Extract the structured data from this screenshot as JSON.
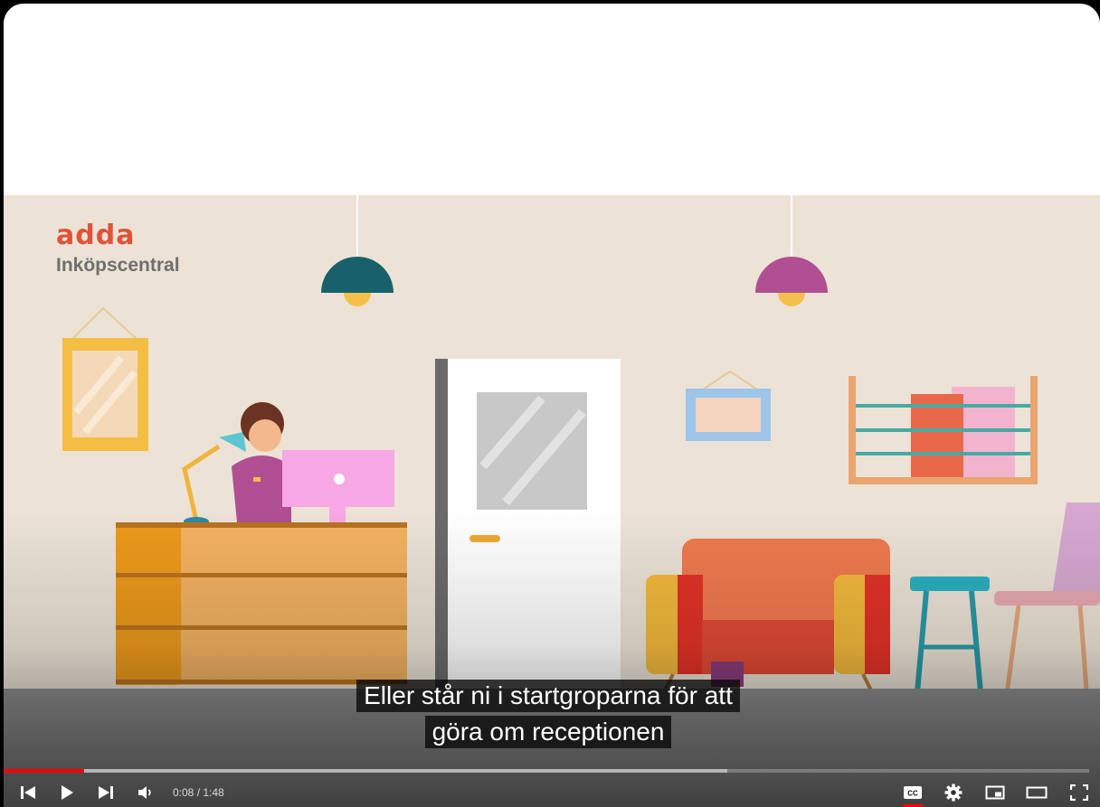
{
  "player": {
    "captions": [
      "Eller står ni i startgroparna för att",
      "göra om receptionen"
    ],
    "time_current": "0:08",
    "time_separator": " / ",
    "time_total": "1:48",
    "played_fraction": 0.074,
    "buffered_fraction": 0.667,
    "accent_color": "#ff0000"
  },
  "scene": {
    "logo_text": "adda",
    "logo_subtitle": "Inköpscentral",
    "logo_color": "#e0533a"
  },
  "controls": {
    "icons": [
      "previous-icon",
      "play-icon",
      "next-icon",
      "volume-icon",
      "closed-captions-icon",
      "settings-gear-icon",
      "miniplayer-icon",
      "theater-mode-icon",
      "fullscreen-icon"
    ]
  }
}
